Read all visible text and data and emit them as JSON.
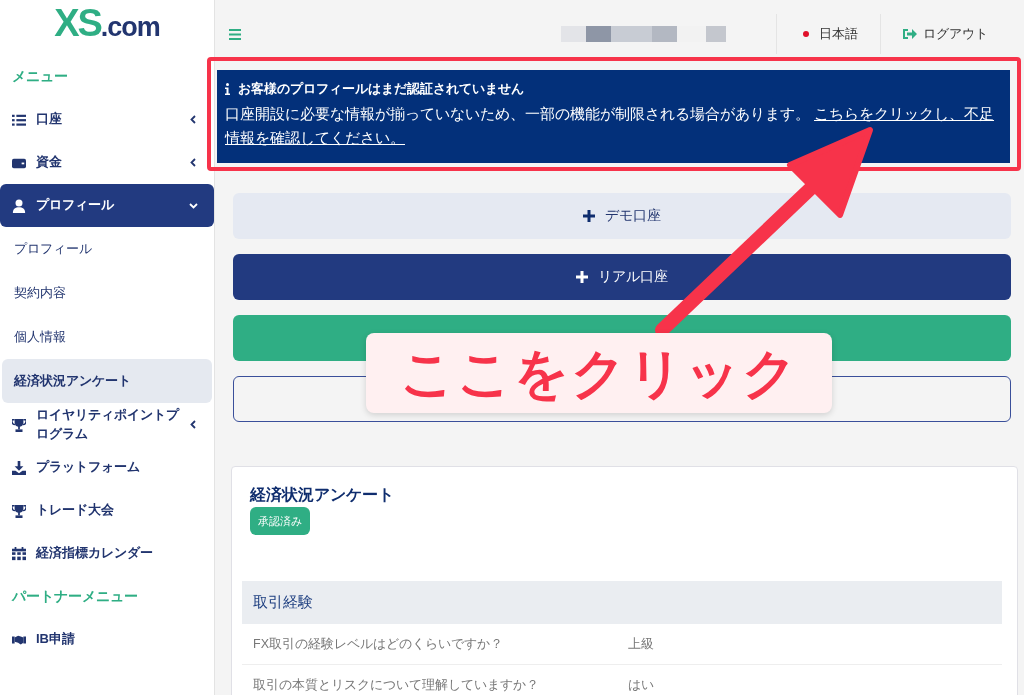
{
  "sidebar": {
    "logo": {
      "mark": "XS",
      "suffix": ".com"
    },
    "items": [
      {
        "kind": "header",
        "label": "メニュー"
      },
      {
        "kind": "item",
        "label": "口座",
        "selected": false,
        "expanded": false
      },
      {
        "kind": "item",
        "label": "資金",
        "selected": false,
        "expanded": false
      },
      {
        "kind": "item",
        "label": "プロフィール",
        "selected": true,
        "expanded": true
      },
      {
        "kind": "subitem",
        "label": "プロフィール",
        "selected": false
      },
      {
        "kind": "subitem",
        "label": "契約内容",
        "selected": false
      },
      {
        "kind": "subitem",
        "label": "個人情報",
        "selected": false
      },
      {
        "kind": "subitem",
        "label": "経済状況アンケート",
        "selected": true
      },
      {
        "kind": "item",
        "label": "ロイヤリティポイントプログラム",
        "selected": false,
        "expanded": false
      },
      {
        "kind": "item",
        "label": "プラットフォーム",
        "selected": false
      },
      {
        "kind": "item",
        "label": "トレード大会",
        "selected": false
      },
      {
        "kind": "item",
        "label": "経済指標カレンダー",
        "selected": false
      },
      {
        "kind": "header",
        "label": "パートナーメニュー"
      },
      {
        "kind": "item",
        "label": "IB申請",
        "selected": false
      }
    ]
  },
  "topbar": {
    "language": "日本語",
    "logout": "ログアウト"
  },
  "alert": {
    "title": "お客様のプロフィールはまだ認証されていません",
    "message": "口座開設に必要な情報が揃っていないため、一部の機能が制限される場合があります。",
    "link_lines": [
      "こちらをクリックし、不足",
      "情報を確認してください。"
    ]
  },
  "actions": [
    {
      "kind": "light",
      "label": "デモ口座"
    },
    {
      "kind": "primary",
      "label": "リアル口座"
    },
    {
      "kind": "success"
    },
    {
      "kind": "outline"
    }
  ],
  "card": {
    "title": "経済状況アンケート",
    "badge": "承認済み",
    "section": "取引経験",
    "rows": [
      {
        "question": "FX取引の経験レベルはどのくらいですか？",
        "answer": "上級"
      },
      {
        "question": "取引の本質とリスクについて理解していますか？",
        "answer": "はい"
      }
    ]
  },
  "annotation": {
    "callout": "ここをクリック"
  }
}
